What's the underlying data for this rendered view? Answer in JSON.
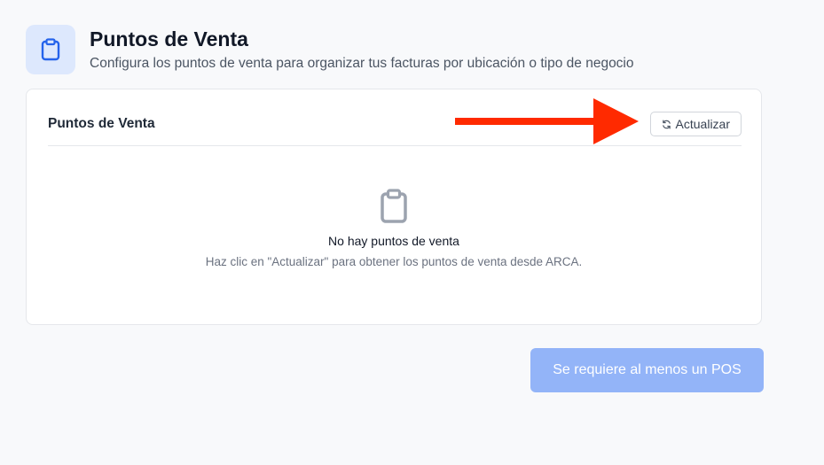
{
  "header": {
    "title": "Puntos de Venta",
    "subtitle": "Configura los puntos de venta para organizar tus facturas por ubicación o tipo de negocio",
    "icon": "clipboard-icon"
  },
  "card": {
    "title": "Puntos de Venta",
    "refresh_label": "Actualizar",
    "refresh_icon": "refresh-icon",
    "empty_state": {
      "icon": "clipboard-icon",
      "title": "No hay puntos de venta",
      "description": "Haz clic en \"Actualizar\" para obtener los puntos de venta desde ARCA."
    }
  },
  "footer": {
    "submit_label": "Se requiere al menos un POS",
    "submit_disabled": true
  },
  "annotation": {
    "arrow_icon": "red-arrow-icon",
    "arrow_color": "#ff2a00"
  },
  "colors": {
    "accent": "#2563eb",
    "accent_light": "#dde8fd",
    "disabled_button": "#93b4f8",
    "background": "#f8f9fb"
  }
}
